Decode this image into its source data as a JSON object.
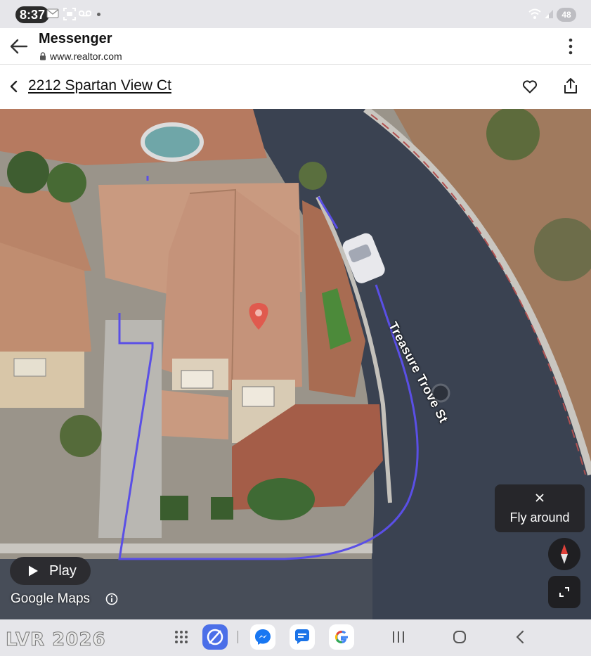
{
  "status_bar": {
    "time": "8:37",
    "battery": "48",
    "icons": [
      "mail-icon",
      "screen-record-icon",
      "voicemail-icon",
      "wifi-icon",
      "signal-icon"
    ]
  },
  "app_bar": {
    "title": "Messenger",
    "url": "www.realtor.com"
  },
  "listing": {
    "address": "2212 Spartan View Ct"
  },
  "map": {
    "street_label": "Treasure Trove St",
    "play_label": "Play",
    "attribution": "Google Maps",
    "fly_around_label": "Fly around",
    "boundary_color": "#5a4fe6",
    "marker_color": "#e05a4e"
  },
  "nav_bar": {
    "watermark": "LVR 2026",
    "apps": [
      "app-drawer-icon",
      "browser-icon",
      "messenger-icon",
      "messages-icon",
      "google-icon"
    ],
    "system": [
      "recents-icon",
      "home-icon",
      "back-icon"
    ]
  }
}
